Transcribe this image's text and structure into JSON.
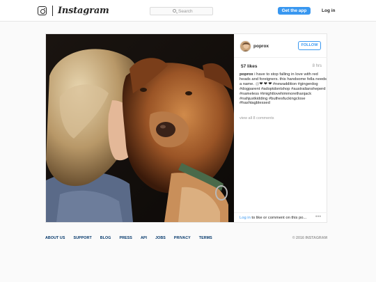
{
  "nav": {
    "brand": "Instagram",
    "search_placeholder": "Search",
    "get_app_label": "Get the app",
    "login_label": "Log in"
  },
  "post": {
    "username": "poprox",
    "follow_label": "FOLLOW",
    "likes": "57 likes",
    "time_ago": "8 hrs",
    "caption": {
      "username": "poprox",
      "text": " i have to stop falling in love with red heads and foreigners. this handsome fella needs a name. ",
      "mention": "@",
      "hearts": "❤ ❤ ❤",
      "hashtags": "#newaddition #gingerdog #dogparent #adoptdontshop #australiansheperd #nameless #imightlovehimmorethanjack #nahjustkidding #buthesfuckingclose #hashtagblessed"
    },
    "view_all_comments": "view all 8 comments",
    "comment_prompt": {
      "link": "Log in",
      "text": " to like or comment on this po..."
    },
    "more_label": "•••"
  },
  "footer": {
    "links": [
      "ABOUT US",
      "SUPPORT",
      "BLOG",
      "PRESS",
      "API",
      "JOBS",
      "PRIVACY",
      "TERMS"
    ],
    "copyright": "© 2016 INSTAGRAM"
  },
  "colors": {
    "accent": "#3897f0",
    "footer_link": "#003569",
    "muted": "#999999"
  }
}
